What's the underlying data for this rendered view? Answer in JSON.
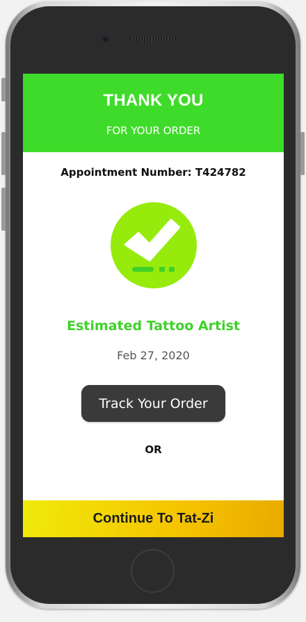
{
  "header": {
    "title": "THANK YOU",
    "subtitle": "FOR YOUR ORDER"
  },
  "order": {
    "appointment_text": "Appointment Number: T424782",
    "estimated_label": "Estimated Tattoo Artist",
    "date": "Feb 27, 2020"
  },
  "actions": {
    "track_label": "Track Your Order",
    "or_label": "OR",
    "continue_label": "Continue To Tat-Zi"
  },
  "icons": {
    "status": "checkmark-icon",
    "camera": "camera-icon",
    "home": "home-button-icon"
  },
  "colors": {
    "header_green": "#3fdb2a",
    "check_green": "#96eb0c",
    "accent_green": "#3fd12a",
    "track_button": "#3a3a3a",
    "continue_yellow": "#f5c400"
  }
}
